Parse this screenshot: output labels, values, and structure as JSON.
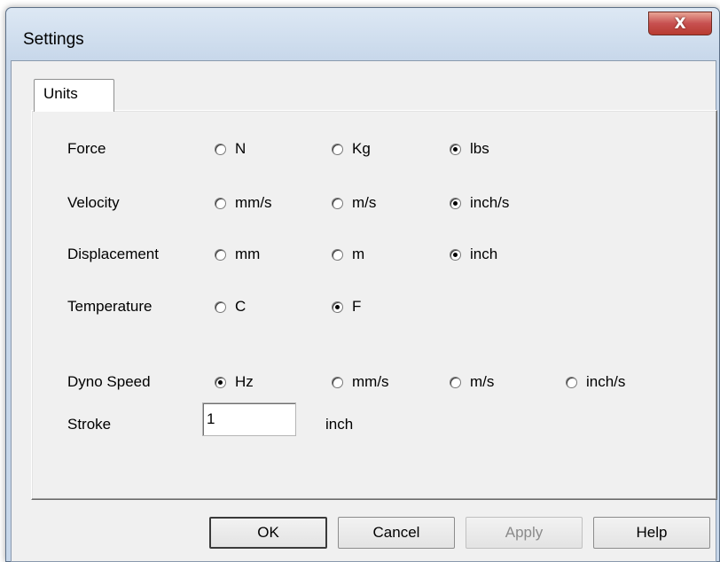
{
  "window": {
    "title": "Settings",
    "close_glyph": "X"
  },
  "tabs": [
    {
      "label": "Units",
      "selected": true
    }
  ],
  "units": {
    "force": {
      "label": "Force",
      "options": [
        "N",
        "Kg",
        "lbs"
      ],
      "selected": "lbs"
    },
    "velocity": {
      "label": "Velocity",
      "options": [
        "mm/s",
        "m/s",
        "inch/s"
      ],
      "selected": "inch/s"
    },
    "displacement": {
      "label": "Displacement",
      "options": [
        "mm",
        "m",
        "inch"
      ],
      "selected": "inch"
    },
    "temperature": {
      "label": "Temperature",
      "options": [
        "C",
        "F"
      ],
      "selected": "F"
    },
    "dyno_speed": {
      "label": "Dyno Speed",
      "options": [
        "Hz",
        "mm/s",
        "m/s",
        "inch/s"
      ],
      "selected": "Hz"
    },
    "stroke": {
      "label": "Stroke",
      "value": "1",
      "unit": "inch"
    }
  },
  "buttons": {
    "ok": "OK",
    "cancel": "Cancel",
    "apply": "Apply",
    "help": "Help"
  },
  "colors": {
    "titlebar": "#c7d7ea",
    "close_button": "#c75050",
    "dialog_face": "#f0f0f0"
  }
}
